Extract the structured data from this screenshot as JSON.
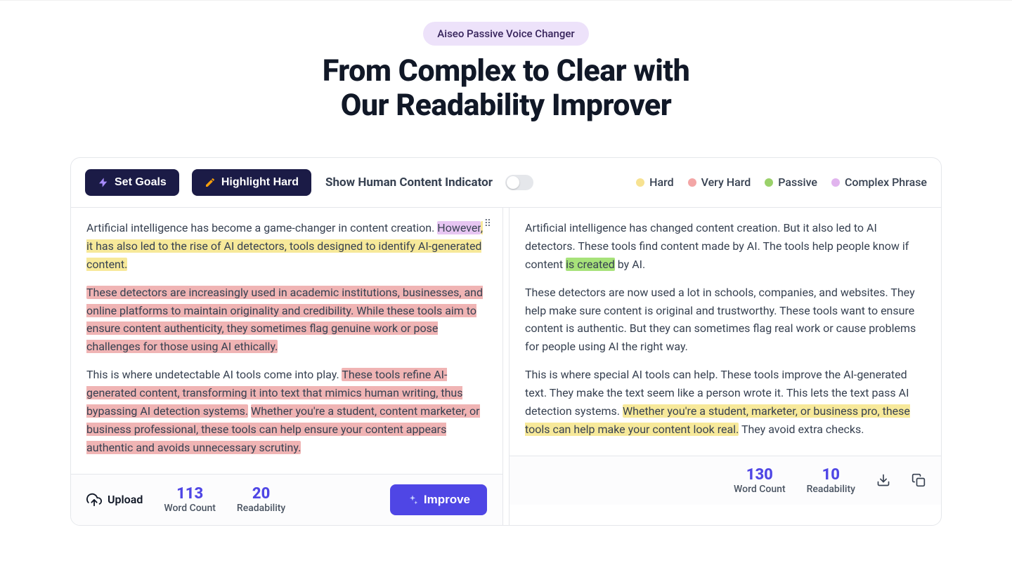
{
  "badge": "Aiseo Passive Voice Changer",
  "title_line1": "From Complex to Clear with",
  "title_line2": "Our Readability Improver",
  "toolbar": {
    "set_goals": "Set Goals",
    "highlight_hard": "Highlight Hard",
    "show_human_indicator": "Show Human Content Indicator"
  },
  "legend": {
    "hard": "Hard",
    "very_hard": "Very Hard",
    "passive": "Passive",
    "complex": "Complex Phrase"
  },
  "left": {
    "p1_plain1": "Artificial intelligence has become a game-changer in content creation. ",
    "p1_complex": "However",
    "p1_hard": ", it has also led to the rise of AI detectors, tools designed to identify AI-generated content.",
    "p2_veryhard": "These detectors are increasingly used in academic institutions, businesses, and online platforms to maintain originality and credibility. While these tools aim to ensure content authenticity, they sometimes flag genuine work or pose challenges for those using AI ethically.",
    "p3_plain": "This is where undetectable AI tools come into play. ",
    "p3_veryhard1": "These tools refine AI-generated content, transforming it into text that mimics human writing, thus bypassing AI detection systems.",
    "p3_space": " ",
    "p3_veryhard2": "Whether you're a student, content marketer, or business professional, these tools can help ensure your content appears authentic and avoids unnecessary scrutiny.",
    "upload": "Upload",
    "word_count": "113",
    "word_count_label": "Word Count",
    "readability": "20",
    "readability_label": "Readability",
    "improve": "Improve"
  },
  "right": {
    "p1a": "Artificial intelligence has changed content creation. But it also led to AI detectors. These tools find content made by AI. The tools help people know if content ",
    "p1_passive": "is created",
    "p1b": " by AI.",
    "p2": "These detectors are now used a lot in schools, companies, and websites. They help make sure content is original and trustworthy. These tools want to ensure content is authentic. But they can sometimes flag real work or cause problems for people using AI the right way.",
    "p3a": "This is where special AI tools can help. These tools improve the AI-generated text. They make the text seem like a person wrote it. This lets the text pass AI detection systems. ",
    "p3_hard": "Whether you're a student, marketer, or business pro, these tools can help make your content look real.",
    "p3b": " They avoid extra checks.",
    "word_count": "130",
    "word_count_label": "Word Count",
    "readability": "10",
    "readability_label": "Readability"
  }
}
